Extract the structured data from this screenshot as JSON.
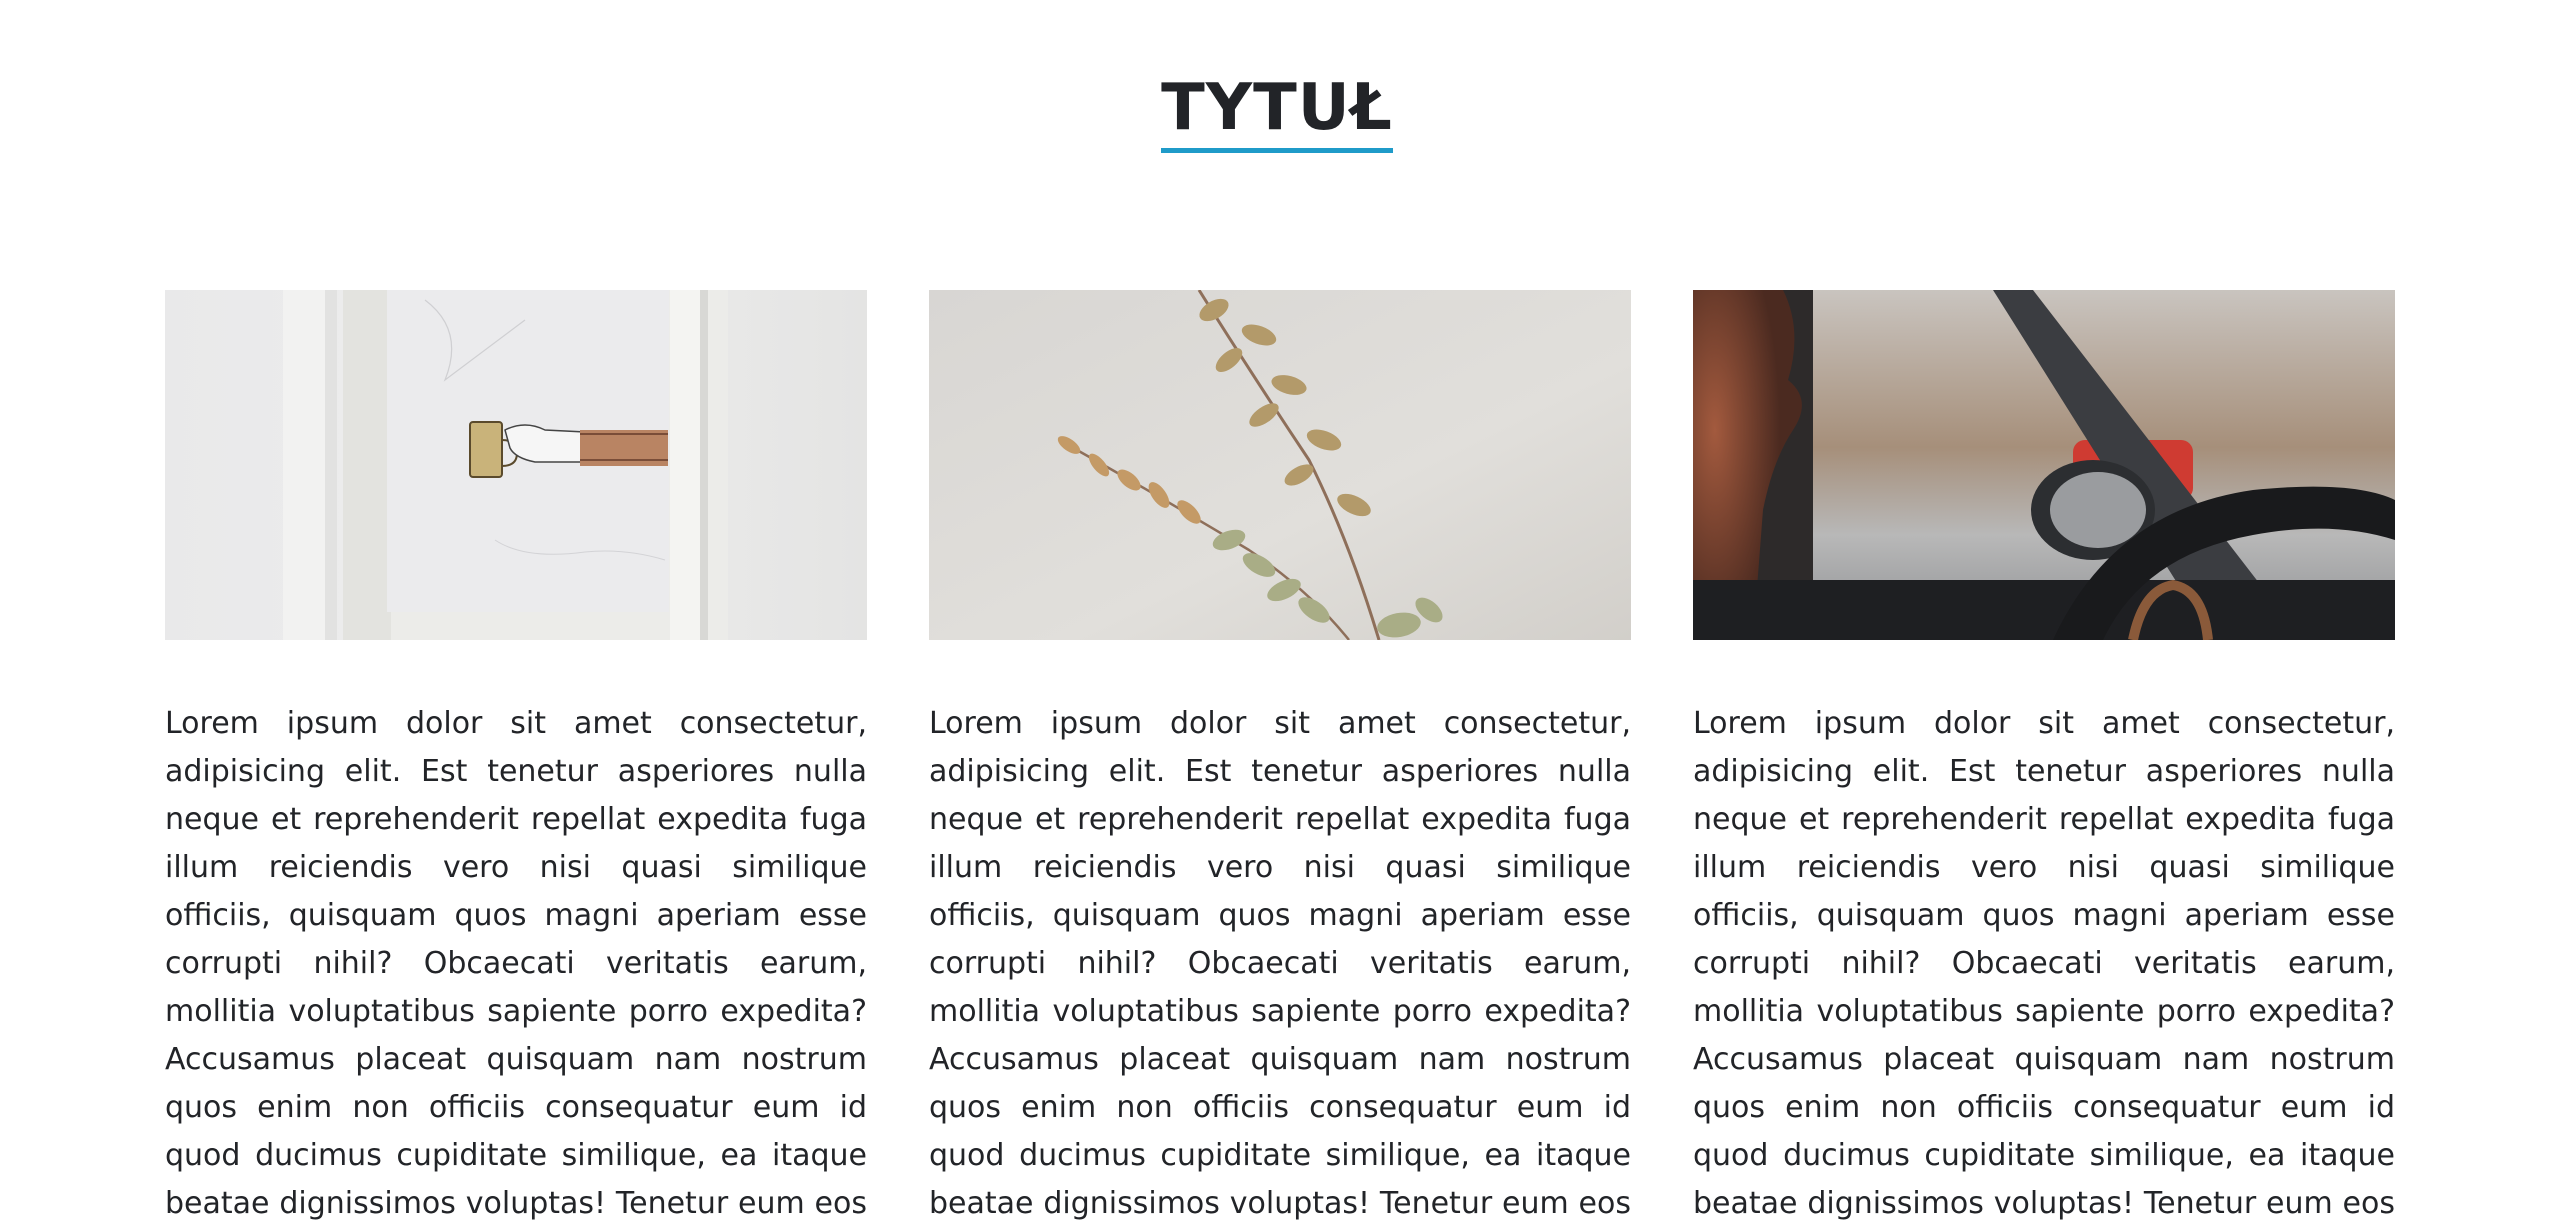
{
  "page": {
    "title": "TYTUŁ",
    "accent_color": "#1f9bc9"
  },
  "cards": [
    {
      "image_icon": "framed-illustration-hand-holding-cup-image",
      "text": "Lorem ipsum dolor sit amet consectetur, adipisicing elit. Est tenetur asperiores nulla neque et reprehenderit repellat expedita fuga illum reiciendis vero nisi quasi similique officiis, quisquam quos magni aperiam esse corrupti nihil? Obcaecati veritatis earum, mollitia voluptatibus sapiente porro expedita? Accusamus placeat quisquam nam nostrum quos enim non officiis consequatur eum id quod ducimus cupiditate similique, ea itaque beatae dignissimos voluptas! Tenetur eum eos vel inventore, consequatur"
    },
    {
      "image_icon": "eucalyptus-branch-image",
      "text": "Lorem ipsum dolor sit amet consectetur, adipisicing elit. Est tenetur asperiores nulla neque et reprehenderit repellat expedita fuga illum reiciendis vero nisi quasi similique officiis, quisquam quos magni aperiam esse corrupti nihil? Obcaecati veritatis earum, mollitia voluptatibus sapiente porro expedita? Accusamus placeat quisquam nam nostrum quos enim non officiis consequatur eum id quod ducimus cupiditate similique, ea itaque beatae dignissimos voluptas! Tenetur eum eos vel inventore, consequatur"
    },
    {
      "image_icon": "car-interior-steering-wheel-image",
      "text": "Lorem ipsum dolor sit amet consectetur, adipisicing elit. Est tenetur asperiores nulla neque et reprehenderit repellat expedita fuga illum reiciendis vero nisi quasi similique officiis, quisquam quos magni aperiam esse corrupti nihil? Obcaecati veritatis earum, mollitia voluptatibus sapiente porro expedita? Accusamus placeat quisquam nam nostrum quos enim non officiis consequatur eum id quod ducimus cupiditate similique, ea itaque beatae dignissimos voluptas! Tenetur eum eos vel inventore, consequatur"
    }
  ]
}
